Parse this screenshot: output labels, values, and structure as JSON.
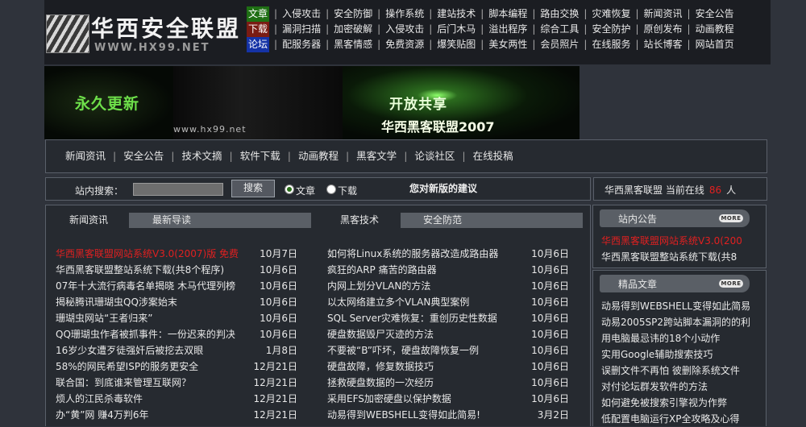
{
  "logo": {
    "name": "华西安全联盟",
    "url": "WWW.HX99.NET"
  },
  "topnav": {
    "rows": [
      {
        "tag": "文章",
        "tag_color": "#1f6f14",
        "items": [
          "入侵攻击",
          "安全防御",
          "操作系统",
          "建站技术",
          "脚本编程",
          "路由交换",
          "灾难恢复",
          "新闻资讯",
          "安全公告"
        ]
      },
      {
        "tag": "下载",
        "tag_color": "#7a1b13",
        "items": [
          "漏洞扫描",
          "加密破解",
          "入侵攻击",
          "后门木马",
          "溢出程序",
          "综合工具",
          "安全防护",
          "原创发布",
          "动画教程"
        ]
      },
      {
        "tag": "论坛",
        "tag_color": "#1533a6",
        "items": [
          "配服务器",
          "黑客情感",
          "免费资源",
          "爆笑贴图",
          "美女两性",
          "会员照片",
          "在线服务",
          "站长博客",
          "网站首页"
        ]
      }
    ]
  },
  "banner": {
    "slogan": "永久更新",
    "url": "www.hx99.net",
    "title1": "开放共享",
    "title2": "华西黑客联盟2007"
  },
  "catnav": [
    "新闻资讯",
    "安全公告",
    "技术文摘",
    "软件下载",
    "动画教程",
    "黑客文学",
    "论谈社区",
    "在线投稿"
  ],
  "search": {
    "label": "站内搜索：",
    "button": "搜索",
    "options": [
      "文章",
      "下载"
    ],
    "selected": "文章",
    "suggest": "您对新版的建议"
  },
  "online": {
    "prefix": "华西黑客联盟 当前在线",
    "count": "86",
    "suffix": "人"
  },
  "tabs": {
    "news": "新闻资讯",
    "guide": "最新导读",
    "hacker": "黑客技术",
    "defense": "安全防范"
  },
  "news_list": [
    {
      "title": "华西黑客联盟网站系统V3.0(2007)版 免费",
      "date": "10月7日",
      "hot": true
    },
    {
      "title": "华西黑客联盟整站系统下载(共8个程序)",
      "date": "10月6日",
      "hot": false
    },
    {
      "title": "07年十大流行病毒名单揭晓 木马代理列榜",
      "date": "10月6日",
      "hot": false
    },
    {
      "title": "揭秘腾讯珊瑚虫QQ涉案始末",
      "date": "10月6日",
      "hot": false
    },
    {
      "title": "珊瑚虫网站“王者归来”",
      "date": "10月6日",
      "hot": false
    },
    {
      "title": "QQ珊瑚虫作者被抓事件：一份迟来的判决",
      "date": "10月6日",
      "hot": false
    },
    {
      "title": "16岁少女遭歹徒强奸后被挖去双眼",
      "date": "1月8日",
      "hot": false
    },
    {
      "title": "58%的网民希望ISP的服务更安全",
      "date": "12月21日",
      "hot": false
    },
    {
      "title": "联合国：到底谁来管理互联网？",
      "date": "12月21日",
      "hot": false
    },
    {
      "title": "烦人的江民杀毒软件",
      "date": "12月21日",
      "hot": false
    },
    {
      "title": "办“黄”网 赚4万判6年",
      "date": "12月21日",
      "hot": false
    }
  ],
  "tech_list": [
    {
      "title": "如何将Linux系统的服务器改造成路由器",
      "date": "10月6日"
    },
    {
      "title": "疯狂的ARP 痛苦的路由器",
      "date": "10月6日"
    },
    {
      "title": "内网上划分VLAN的方法",
      "date": "10月6日"
    },
    {
      "title": "以太网络建立多个VLAN典型案例",
      "date": "10月6日"
    },
    {
      "title": "SQL Server灾难恢复：重创历史性数据",
      "date": "10月6日"
    },
    {
      "title": "硬盘数据毁尸灭迹的方法",
      "date": "10月6日"
    },
    {
      "title": "不要被“B”吓坏，硬盘故障恢复一例",
      "date": "10月6日"
    },
    {
      "title": "硬盘故障，修复数据技巧",
      "date": "10月6日"
    },
    {
      "title": "拯救硬盘数据的一次经历",
      "date": "10月6日"
    },
    {
      "title": "采用EFS加密硬盘以保护数据",
      "date": "10月6日"
    },
    {
      "title": "动易得到WEBSHELL变得如此简易!",
      "date": "3月2日"
    }
  ],
  "notice": {
    "title": "站内公告",
    "more": "MORE",
    "items": [
      {
        "title": "华西黑客联盟网站系统V3.0(200",
        "hot": true
      },
      {
        "title": "华西黑客联盟整站系统下载(共8",
        "hot": false
      }
    ]
  },
  "featured": {
    "title": "精品文章",
    "more": "MORE",
    "items": [
      "动易得到WEBSHELL变得如此简易",
      "动易2005SP2跨站脚本漏洞的的利",
      "用电脑最忌讳的18个小动作",
      "实用Google辅助搜索技巧",
      "误删文件不再怕 彼删除系统文件",
      "对付论坛群发软件的方法",
      "如何避免被搜索引擎视为作弊",
      "低配置电脑运行XP全攻略及心得"
    ]
  }
}
